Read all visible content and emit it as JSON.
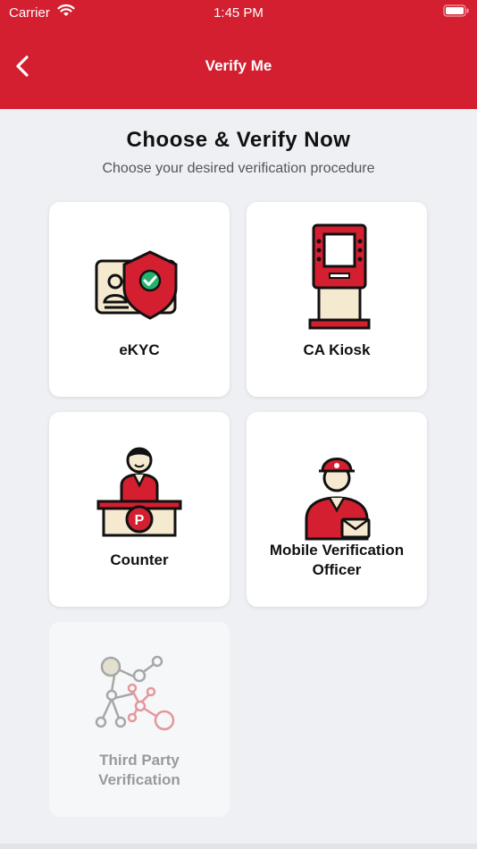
{
  "status_bar": {
    "carrier": "Carrier",
    "time": "1:45 PM"
  },
  "nav": {
    "title": "Verify Me",
    "back_icon": "chevron-left-icon"
  },
  "page": {
    "title": "Choose & Verify Now",
    "subtitle": "Choose your desired verification procedure"
  },
  "options": [
    {
      "label": "eKYC",
      "icon": "id-card-shield-icon",
      "enabled": true
    },
    {
      "label": "CA Kiosk",
      "icon": "kiosk-icon",
      "enabled": true
    },
    {
      "label": "Counter",
      "icon": "counter-agent-icon",
      "enabled": true
    },
    {
      "label": "Mobile Verification Officer",
      "icon": "delivery-officer-icon",
      "enabled": true
    },
    {
      "label": "Third Party Verification",
      "icon": "network-nodes-icon",
      "enabled": false
    }
  ],
  "colors": {
    "brand_red": "#d31f30",
    "background": "#eef0f4",
    "card": "#ffffff"
  }
}
